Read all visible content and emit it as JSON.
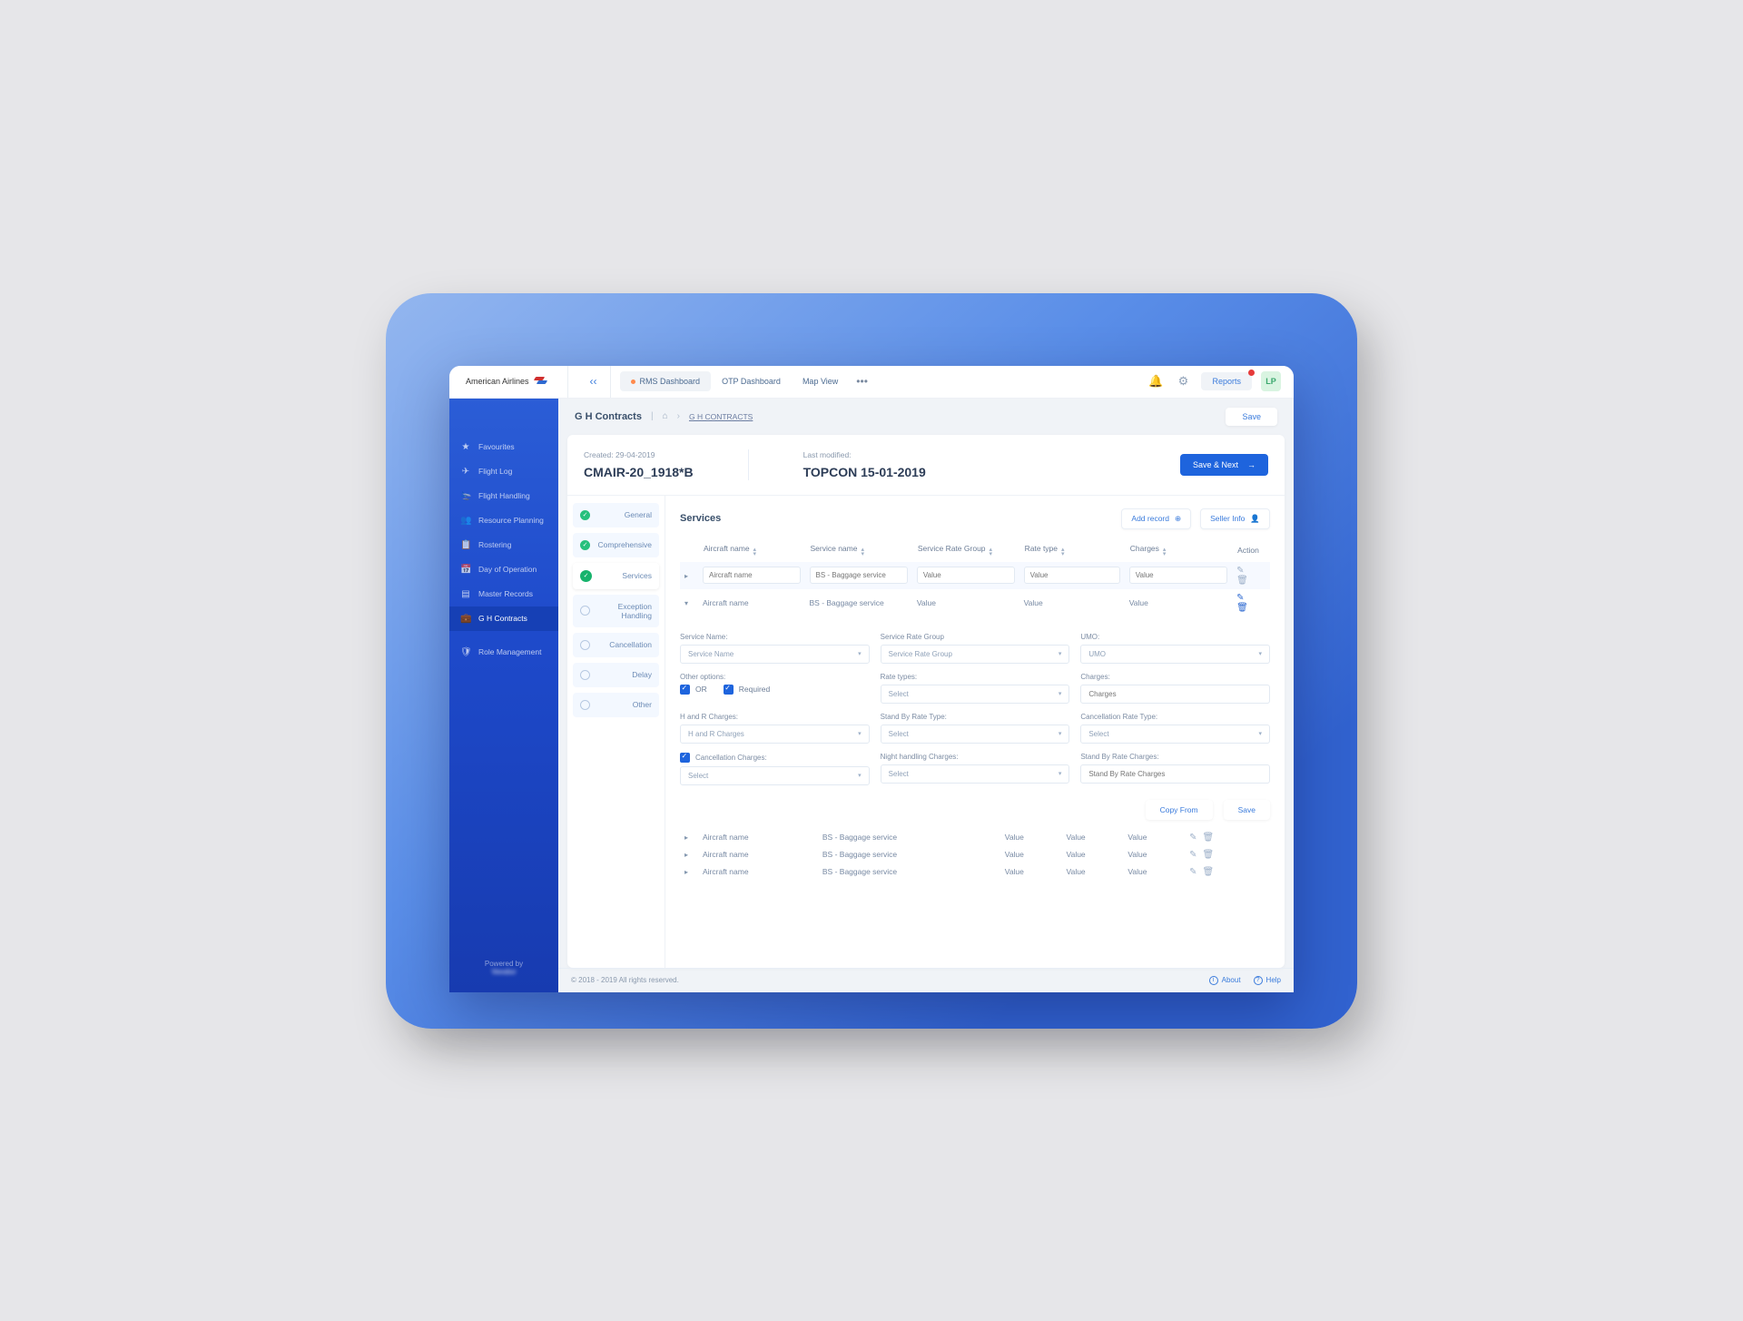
{
  "brand": "American Airlines",
  "top_tabs": {
    "rms": "RMS Dashboard",
    "otp": "OTP Dashboard",
    "map": "Map View"
  },
  "reports": "Reports",
  "avatar": "LP",
  "sidebar": {
    "items": [
      {
        "label": "Favourites"
      },
      {
        "label": "Flight Log"
      },
      {
        "label": "Flight Handling"
      },
      {
        "label": "Resource Planning"
      },
      {
        "label": "Rostering"
      },
      {
        "label": "Day of Operation"
      },
      {
        "label": "Master Records"
      },
      {
        "label": "G H Contracts"
      },
      {
        "label": "Role Management"
      }
    ],
    "powered": "Powered by"
  },
  "page": {
    "title": "G H Contracts",
    "breadcrumb_link": "G H CONTRACTS",
    "save": "Save"
  },
  "meta": {
    "created_label": "Created: 29-04-2019",
    "created_value": "CMAIR-20_1918*B",
    "modified_label": "Last modified:",
    "modified_value": "TOPCON 15-01-2019",
    "save_next": "Save & Next"
  },
  "steps": [
    "General",
    "Comprehensive",
    "Services",
    "Exception Handling",
    "Cancellation",
    "Delay",
    "Other"
  ],
  "section": {
    "title": "Services",
    "add": "Add record",
    "seller": "Seller Info"
  },
  "columns": {
    "c1": "Aircraft  name",
    "c2": "Service name",
    "c3": "Service Rate Group",
    "c4": "Rate type",
    "c5": "Charges",
    "c6": "Action"
  },
  "rows": {
    "aircraft": "Aircraft name",
    "service": "BS - Baggage service",
    "value": "Value"
  },
  "placeholders": {
    "aircraft": "Aircraft name",
    "service": "BS - Baggage service",
    "value": "Value"
  },
  "form": {
    "service_name_l": "Service Name:",
    "service_name_ph": "Service Name",
    "srg_l": "Service Rate Group",
    "srg_ph": "Service Rate Group",
    "umo_l": "UMO:",
    "umo_ph": "UMO",
    "other_options_l": "Other options:",
    "or": "OR",
    "required": "Required",
    "rate_types_l": "Rate types:",
    "charges_l": "Charges:",
    "charges_ph": "Charges",
    "hr_l": "H and R Charges:",
    "hr_ph": "H and R Charges",
    "standby_type_l": "Stand By Rate Type:",
    "cancel_type_l": "Cancellation Rate Type:",
    "cc_l": "Cancellation Charges:",
    "night_l": "Night handling Charges:",
    "standby_charges_l": "Stand By Rate Charges:",
    "standby_charges_ph": "Stand By Rate Charges",
    "select": "Select",
    "copy": "Copy From",
    "save": "Save"
  },
  "footer": {
    "copy": "© 2018 - 2019 All rights reserved.",
    "about": "About",
    "help": "Help"
  }
}
